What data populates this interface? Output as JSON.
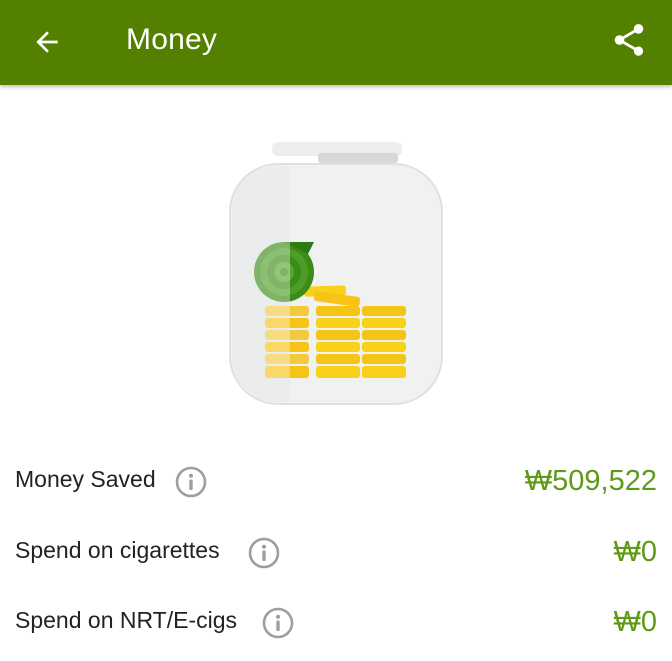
{
  "app_bar": {
    "title": "Money",
    "back_icon": "arrow-back-icon",
    "share_icon": "share-icon",
    "color": "#548000"
  },
  "illustration": {
    "icon": "money-jar-icon"
  },
  "stats": [
    {
      "label": "Money Saved",
      "value": "₩509,522",
      "info_icon": "info-icon"
    },
    {
      "label": "Spend on cigarettes",
      "value": "₩0",
      "info_icon": "info-icon"
    },
    {
      "label": "Spend on NRT/E-cigs",
      "value": "₩0",
      "info_icon": "info-icon"
    }
  ],
  "colors": {
    "value_green": "#5f9a17",
    "label": "#222222"
  }
}
